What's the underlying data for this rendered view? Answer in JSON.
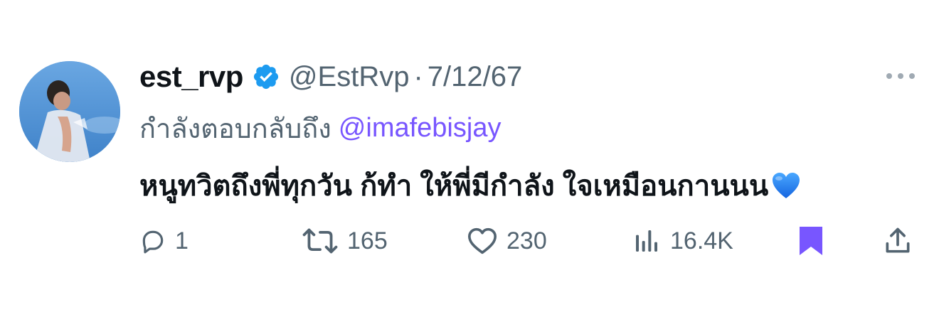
{
  "tweet": {
    "display_name": "est_rvp",
    "verified": true,
    "handle": "@EstRvp",
    "separator": "·",
    "date": "7/12/67",
    "replying_label": "กำลังตอบกลับถึง",
    "replying_to": "@imafebisjay",
    "text": "หนูทวิตถึงพี่ทุกวัน ก้ทำ ให้พี่มีกำลัง ใจเหมือนกานนน",
    "emoji": "💙"
  },
  "actions": {
    "reply_count": "1",
    "retweet_count": "165",
    "like_count": "230",
    "view_count": "16.4K"
  },
  "colors": {
    "verified_badge": "#1d9bf0",
    "mention": "#7856ff",
    "bookmark_active": "#7856ff",
    "secondary_text": "#536471"
  },
  "icons": [
    "verified-badge-icon",
    "more-icon",
    "reply-icon",
    "retweet-icon",
    "like-icon",
    "views-icon",
    "bookmark-icon",
    "share-icon",
    "blue-heart-emoji"
  ]
}
